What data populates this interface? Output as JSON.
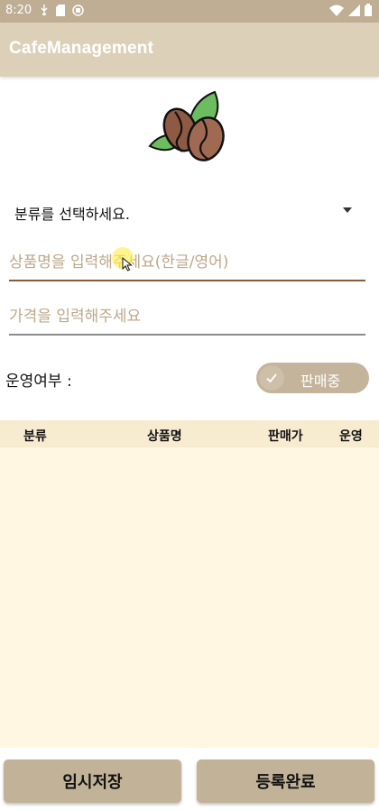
{
  "status_bar": {
    "time": "8:20",
    "left_icons": [
      "usb-icon",
      "sd-card-icon",
      "app-notification-icon"
    ],
    "right_icons": [
      "wifi-icon",
      "signal-icon",
      "battery-icon"
    ]
  },
  "app_bar": {
    "title": "CafeManagement"
  },
  "logo": {
    "icon": "coffee-beans-icon"
  },
  "form": {
    "category_spinner": {
      "selected": "분류를 선택하세요."
    },
    "product_name": {
      "value": "",
      "placeholder": "상품명을 입력해주세요(한글/영어)"
    },
    "price": {
      "value": "",
      "placeholder": "가격을 입력해주세요"
    },
    "operation": {
      "label": "운영여부 :",
      "switch_text": "판매중",
      "checked": true
    }
  },
  "table": {
    "headers": [
      "분류",
      "상품명",
      "판매가",
      "운영"
    ],
    "rows": []
  },
  "buttons": {
    "temp_save": "임시저장",
    "complete": "등록완료"
  },
  "colors": {
    "status_bar": "#bfae94",
    "app_bar": "#ddd0b8",
    "button": "#c2b398",
    "table_header": "#f7ebd0",
    "table_body": "#fff7e2",
    "toggle": "#c4b49b",
    "focus_line": "#8a5a34"
  }
}
